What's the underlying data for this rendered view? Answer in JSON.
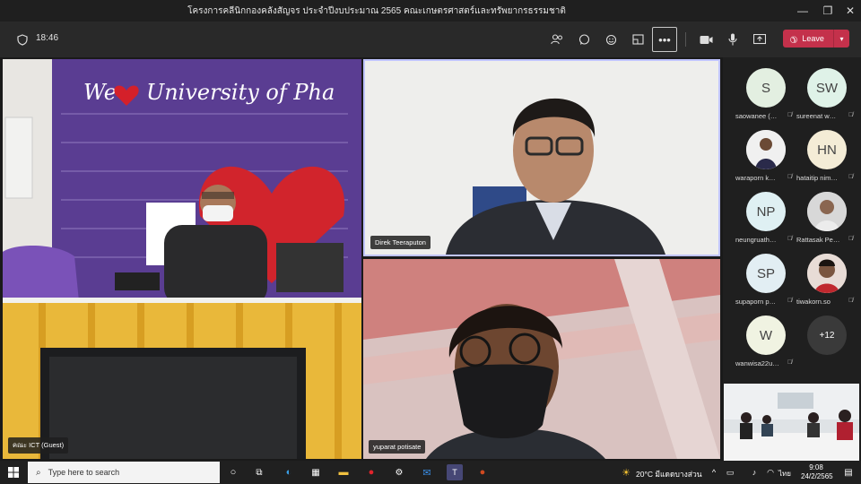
{
  "window": {
    "title": "โครงการคลีนิกกองคลังสัญจร ประจำปีงบประมาณ 2565 คณะเกษตรศาสตร์และทรัพยากรธรรมชาติ"
  },
  "toolbar": {
    "timer": "18:46",
    "leave_label": "Leave"
  },
  "participants_video": [
    {
      "name": "คณะ ICT (Guest)"
    },
    {
      "name": "Direk Teeraputon"
    },
    {
      "name": "yuparat potisate"
    }
  ],
  "roster": [
    {
      "initials": "S",
      "name": "saowanee (…",
      "color": "#e3efe1"
    },
    {
      "initials": "SW",
      "name": "sureenat w…",
      "color": "#dff2e8"
    },
    {
      "initials": "",
      "name": "waraporn k…",
      "color": "#f2f2f2"
    },
    {
      "initials": "HN",
      "name": "hataitip nim…",
      "color": "#f4ecd6"
    },
    {
      "initials": "NP",
      "name": "neungruath…",
      "color": "#dff0f3"
    },
    {
      "initials": "",
      "name": "Rattasak Pe…",
      "color": "#dcdcdc"
    },
    {
      "initials": "SP",
      "name": "supaporn p…",
      "color": "#e2eef3"
    },
    {
      "initials": "",
      "name": "tiwakorn.so",
      "color": "#e6d6d0"
    },
    {
      "initials": "W",
      "name": "wanwisa22u…",
      "color": "#f0f3e2"
    },
    {
      "initials": "+12",
      "name": "",
      "color": "#3a3a3a"
    }
  ],
  "taskbar": {
    "search_placeholder": "Type here to search",
    "weather": "20°C มีแดดบางส่วน",
    "lang": "ไทย",
    "time": "9:08",
    "date": "24/2/2565"
  },
  "colors": {
    "leave": "#c4314b",
    "accent_border": "#c0c4ff"
  }
}
